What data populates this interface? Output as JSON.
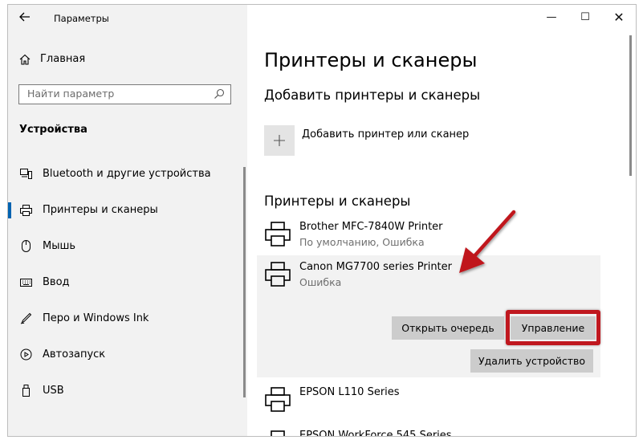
{
  "titlebar": {
    "title": "Параметры",
    "back_icon": "back-arrow-icon",
    "minimize_glyph": "—",
    "maximize_glyph": "☐",
    "close_glyph": "✕"
  },
  "sidebar": {
    "home_label": "Главная",
    "search_placeholder": "Найти параметр",
    "section_title": "Устройства",
    "items": [
      {
        "label": "Bluetooth и другие устройства",
        "icon": "bluetooth-devices-icon"
      },
      {
        "label": "Принтеры и сканеры",
        "icon": "printer-icon",
        "active": true
      },
      {
        "label": "Мышь",
        "icon": "mouse-icon"
      },
      {
        "label": "Ввод",
        "icon": "keyboard-icon"
      },
      {
        "label": "Перо и Windows Ink",
        "icon": "pen-icon"
      },
      {
        "label": "Автозапуск",
        "icon": "autoplay-icon"
      },
      {
        "label": "USB",
        "icon": "usb-icon"
      }
    ]
  },
  "main": {
    "page_title": "Принтеры и сканеры",
    "add_section_title": "Добавить принтеры и сканеры",
    "add_label": "Добавить принтер или сканер",
    "list_section_title": "Принтеры и сканеры",
    "printers": [
      {
        "name": "Brother MFC-7840W Printer",
        "status": "По умолчанию, Ошибка"
      },
      {
        "name": "Canon MG7700 series Printer",
        "status": "Ошибка"
      },
      {
        "name": "EPSON L110 Series",
        "status": ""
      },
      {
        "name": "EPSON WorkForce 545 Series",
        "status": ""
      }
    ],
    "buttons": {
      "open_queue": "Открыть очередь",
      "manage": "Управление",
      "remove": "Удалить устройство"
    }
  },
  "colors": {
    "accent": "#0063b1",
    "highlight": "#c0181f",
    "arrow": "#c0181f"
  }
}
